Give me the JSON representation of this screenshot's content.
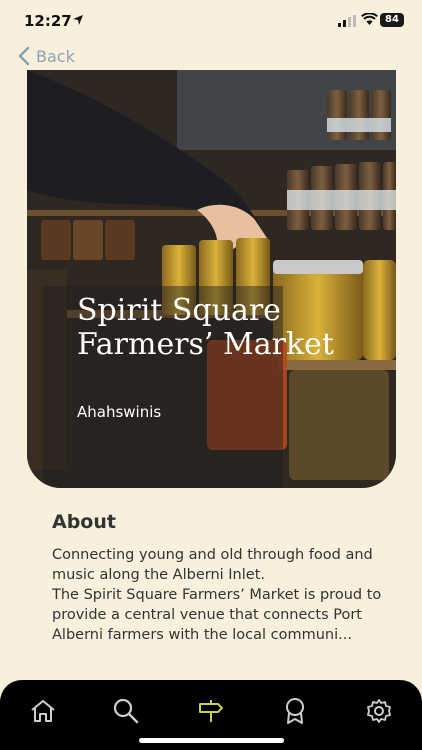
{
  "status": {
    "time": "12:27",
    "battery": "84"
  },
  "nav": {
    "back_label": "Back"
  },
  "hero": {
    "title": "Spirit Square Farmers’ Market",
    "subtitle": "Ahahswinis"
  },
  "about": {
    "heading": "About",
    "text": "Connecting young and old through food and music along the Alberni Inlet.\nThe Spirit Square Farmers’ Market is proud to provide a central venue that connects Port Alberni farmers with the local communi..."
  },
  "tabs": [
    {
      "icon": "home-icon",
      "active": false
    },
    {
      "icon": "search-icon",
      "active": false
    },
    {
      "icon": "signpost-icon",
      "active": true
    },
    {
      "icon": "badge-icon",
      "active": false
    },
    {
      "icon": "gear-icon",
      "active": false
    }
  ],
  "colors": {
    "background": "#f8f0dc",
    "active_tab": "#c8d04a",
    "tab_icon": "#cfcfcf",
    "back_link": "#8aa3b3"
  }
}
